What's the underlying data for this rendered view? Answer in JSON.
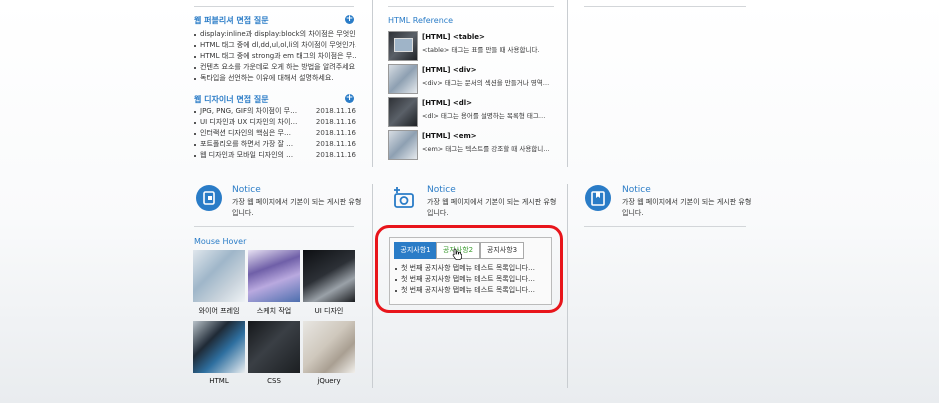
{
  "publisher": {
    "title": "웹 퍼블리셔 면접 질문",
    "items": [
      "display:inline과 display:block의 차이점은 무엇인가…",
      "HTML 태그 중에 dl,dd,ul,ol,li의 차이점이 무엇인가…",
      "HTML 태그 중에 strong과 em 태그의 차이점은 무…",
      "컨텐츠 요소를 가운데로 오게 하는 방법을 알려주세요!",
      "독타입을 선언하는 이유에 대해서 설명하세요."
    ]
  },
  "designer": {
    "title": "웹 디자이너 면접 질문",
    "items": [
      {
        "text": "JPG, PNG, GIF의 차이점이 무…",
        "date": "2018.11.16"
      },
      {
        "text": "UI 디자인과 UX 디자인의 차이…",
        "date": "2018.11.16"
      },
      {
        "text": "인터랙션 디자인의 핵심은 무…",
        "date": "2018.11.16"
      },
      {
        "text": "포트폴리오를 하면서 가장 잘 …",
        "date": "2018.11.16"
      },
      {
        "text": "웹 디자인과 모바일 디자인의 …",
        "date": "2018.11.16"
      }
    ]
  },
  "reference": {
    "title": "HTML Reference",
    "items": [
      {
        "heading": "[HTML] <table>",
        "desc": "<table> 태그는 표를 만들 때 사용합니다."
      },
      {
        "heading": "[HTML] <div>",
        "desc": "<div> 태그는 문서의 섹션을 만들거나 영역…"
      },
      {
        "heading": "[HTML] <dl>",
        "desc": "<dl> 태그는 용어를 설명하는 목록형 태그…"
      },
      {
        "heading": "[HTML] <em>",
        "desc": "<em> 태그는 텍스트를 강조할 때 사용합니…"
      }
    ]
  },
  "notices": [
    {
      "title": "Notice",
      "desc": "가장 웹 페이지에서 기본이 되는 게시판 유형입니다.",
      "icon": "tablet-icon"
    },
    {
      "title": "Notice",
      "desc": "가장 웹 페이지에서 기본이 되는 게시판 유형입니다.",
      "icon": "camera-add-icon"
    },
    {
      "title": "Notice",
      "desc": "가장 웹 페이지에서 기본이 되는 게시판 유형입니다.",
      "icon": "bookmark-book-icon"
    }
  ],
  "gallery": {
    "title": "Mouse Hover",
    "items": [
      "와이어 프레임",
      "스케치 작업",
      "UI 디자인",
      "HTML",
      "CSS",
      "jQuery"
    ]
  },
  "tabs": {
    "labels": [
      "공지사항1",
      "공지사항2",
      "공지사항3"
    ],
    "active_index": 0,
    "hover_index": 1,
    "items": [
      "첫 번째 공지사항 탭메뉴 테스트 목록입니다…",
      "첫 번째 공지사항 탭메뉴 테스트 목록입니다…",
      "첫 번째 공지사항 탭메뉴 테스트 목록입니다…"
    ]
  },
  "colors": {
    "accent": "#2a7cc7",
    "highlight": "#e8151b",
    "hover_text": "#3a9b2e"
  }
}
